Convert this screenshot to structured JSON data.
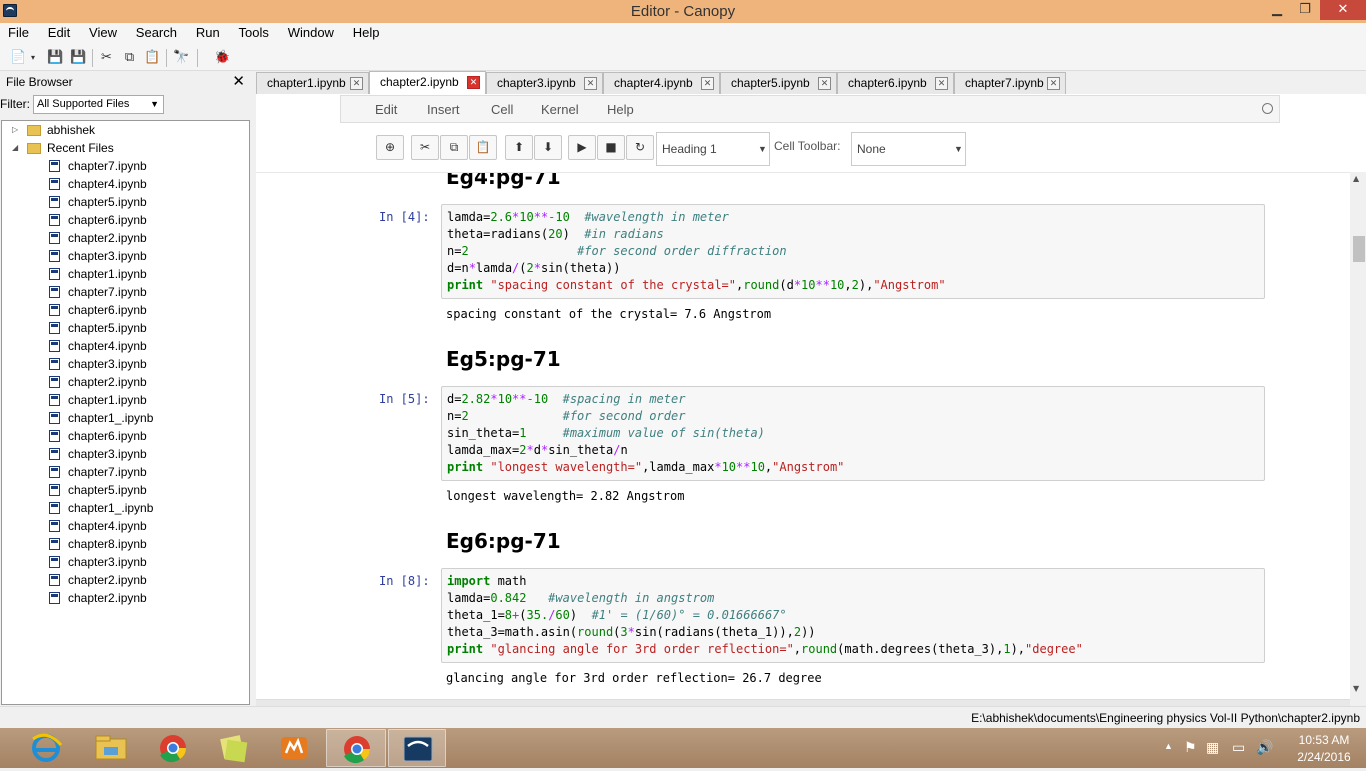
{
  "window": {
    "title": "Editor - Canopy",
    "min": "▁",
    "max": "❐",
    "close": "✕"
  },
  "menubar": [
    "File",
    "Edit",
    "View",
    "Search",
    "Run",
    "Tools",
    "Window",
    "Help"
  ],
  "file_browser": {
    "title": "File Browser",
    "close": "✕",
    "filter_label": "Filter:",
    "filter_value": "All Supported Files",
    "folders": [
      {
        "name": "abhishek",
        "expanded": false
      },
      {
        "name": "Recent Files",
        "expanded": true
      }
    ],
    "files": [
      "chapter7.ipynb",
      "chapter4.ipynb",
      "chapter5.ipynb",
      "chapter6.ipynb",
      "chapter2.ipynb",
      "chapter3.ipynb",
      "chapter1.ipynb",
      "chapter7.ipynb",
      "chapter6.ipynb",
      "chapter5.ipynb",
      "chapter4.ipynb",
      "chapter3.ipynb",
      "chapter2.ipynb",
      "chapter1.ipynb",
      "chapter1_.ipynb",
      "chapter6.ipynb",
      "chapter3.ipynb",
      "chapter7.ipynb",
      "chapter5.ipynb",
      "chapter1_.ipynb",
      "chapter4.ipynb",
      "chapter8.ipynb",
      "chapter3.ipynb",
      "chapter2.ipynb",
      "chapter2.ipynb"
    ]
  },
  "tabs": [
    {
      "label": "chapter1.ipynb",
      "active": false
    },
    {
      "label": "chapter2.ipynb",
      "active": true
    },
    {
      "label": "chapter3.ipynb",
      "active": false
    },
    {
      "label": "chapter4.ipynb",
      "active": false
    },
    {
      "label": "chapter5.ipynb",
      "active": false
    },
    {
      "label": "chapter6.ipynb",
      "active": false
    },
    {
      "label": "chapter7.ipynb",
      "active": false
    }
  ],
  "notebook_menu": [
    "Edit",
    "Insert",
    "Cell",
    "Kernel",
    "Help"
  ],
  "notebook_toolbar": {
    "cell_type": "Heading 1",
    "cell_toolbar_label": "Cell Toolbar:",
    "cell_toolbar_value": "None"
  },
  "cells": [
    {
      "heading": "Eg4:pg-71",
      "prompt": "In [4]:",
      "code": [
        [
          [
            "",
            "lamda="
          ],
          [
            "num",
            "2.6"
          ],
          [
            "op",
            "*"
          ],
          [
            "num",
            "10"
          ],
          [
            "op",
            "**-"
          ],
          [
            "num",
            "10"
          ],
          [
            "",
            "  "
          ],
          [
            "cm",
            "#wavelength in meter"
          ]
        ],
        [
          [
            "",
            "theta=radians("
          ],
          [
            "num",
            "20"
          ],
          [
            "",
            ")  "
          ],
          [
            "cm",
            "#in radians"
          ]
        ],
        [
          [
            "",
            "n="
          ],
          [
            "num",
            "2"
          ],
          [
            "",
            "               "
          ],
          [
            "cm",
            "#for second order diffraction"
          ]
        ],
        [
          [
            "",
            "d=n"
          ],
          [
            "op",
            "*"
          ],
          [
            "",
            "lamda"
          ],
          [
            "op",
            "/"
          ],
          [
            "",
            "("
          ],
          [
            "num",
            "2"
          ],
          [
            "op",
            "*"
          ],
          [
            "",
            "sin(theta))"
          ]
        ],
        [
          [
            "kw",
            "print"
          ],
          [
            "",
            " "
          ],
          [
            "str",
            "\"spacing constant of the crystal=\""
          ],
          [
            "",
            ","
          ],
          [
            "num",
            "round"
          ],
          [
            "",
            "(d"
          ],
          [
            "op",
            "*"
          ],
          [
            "num",
            "10"
          ],
          [
            "op",
            "**"
          ],
          [
            "num",
            "10"
          ],
          [
            "",
            ","
          ],
          [
            "num",
            "2"
          ],
          [
            "",
            "),"
          ],
          [
            "str",
            "\"Angstrom\""
          ]
        ]
      ],
      "output": "spacing constant of the crystal= 7.6 Angstrom"
    },
    {
      "heading": "Eg5:pg-71",
      "prompt": "In [5]:",
      "code": [
        [
          [
            "",
            "d="
          ],
          [
            "num",
            "2.82"
          ],
          [
            "op",
            "*"
          ],
          [
            "num",
            "10"
          ],
          [
            "op",
            "**-"
          ],
          [
            "num",
            "10"
          ],
          [
            "",
            "  "
          ],
          [
            "cm",
            "#spacing in meter"
          ]
        ],
        [
          [
            "",
            "n="
          ],
          [
            "num",
            "2"
          ],
          [
            "",
            "             "
          ],
          [
            "cm",
            "#for second order"
          ]
        ],
        [
          [
            "",
            "sin_theta="
          ],
          [
            "num",
            "1"
          ],
          [
            "",
            "     "
          ],
          [
            "cm",
            "#maximum value of sin(theta)"
          ]
        ],
        [
          [
            "",
            "lamda_max="
          ],
          [
            "num",
            "2"
          ],
          [
            "op",
            "*"
          ],
          [
            "",
            "d"
          ],
          [
            "op",
            "*"
          ],
          [
            "",
            "sin_theta"
          ],
          [
            "op",
            "/"
          ],
          [
            "",
            "n"
          ]
        ],
        [
          [
            "kw",
            "print"
          ],
          [
            "",
            " "
          ],
          [
            "str",
            "\"longest wavelength=\""
          ],
          [
            "",
            ",lamda_max"
          ],
          [
            "op",
            "*"
          ],
          [
            "num",
            "10"
          ],
          [
            "op",
            "**"
          ],
          [
            "num",
            "10"
          ],
          [
            "",
            ","
          ],
          [
            "str",
            "\"Angstrom\""
          ]
        ]
      ],
      "output": "longest wavelength= 2.82 Angstrom"
    },
    {
      "heading": "Eg6:pg-71",
      "prompt": "In [8]:",
      "code": [
        [
          [
            "kw",
            "import"
          ],
          [
            "",
            " math"
          ]
        ],
        [
          [
            "",
            "lamda="
          ],
          [
            "num",
            "0.842"
          ],
          [
            "",
            "   "
          ],
          [
            "cm",
            "#wavelength in angstrom"
          ]
        ],
        [
          [
            "",
            "theta_1="
          ],
          [
            "num",
            "8"
          ],
          [
            "op",
            "+"
          ],
          [
            "",
            "("
          ],
          [
            "num",
            "35."
          ],
          [
            "op",
            "/"
          ],
          [
            "num",
            "60"
          ],
          [
            "",
            ")  "
          ],
          [
            "cm",
            "#1' = (1/60)° = 0.01666667°"
          ]
        ],
        [
          [
            "",
            "theta_3=math.asin("
          ],
          [
            "num",
            "round"
          ],
          [
            "",
            "("
          ],
          [
            "num",
            "3"
          ],
          [
            "op",
            "*"
          ],
          [
            "",
            "sin(radians(theta_1)),"
          ],
          [
            "num",
            "2"
          ],
          [
            "",
            "))"
          ]
        ],
        [
          [
            "kw",
            "print"
          ],
          [
            "",
            " "
          ],
          [
            "str",
            "\"glancing angle for 3rd order reflection=\""
          ],
          [
            "",
            ","
          ],
          [
            "num",
            "round"
          ],
          [
            "",
            "(math.degrees(theta_3),"
          ],
          [
            "num",
            "1"
          ],
          [
            "",
            "),"
          ],
          [
            "str",
            "\"degree\""
          ]
        ]
      ],
      "output": "glancing angle for 3rd order reflection= 26.7 degree"
    }
  ],
  "statusbar": {
    "path": "E:\\abhishek\\documents\\Engineering physics Vol-II Python\\chapter2.ipynb"
  },
  "taskbar": {
    "time": "10:53 AM",
    "date": "2/24/2016"
  },
  "colors": {
    "titlebar": "#eeb47c",
    "close": "#c7493c",
    "prompt": "#303f9f",
    "keyword": "#008000",
    "string": "#ba2121",
    "comment": "#408080",
    "operator": "#aa22ff"
  }
}
